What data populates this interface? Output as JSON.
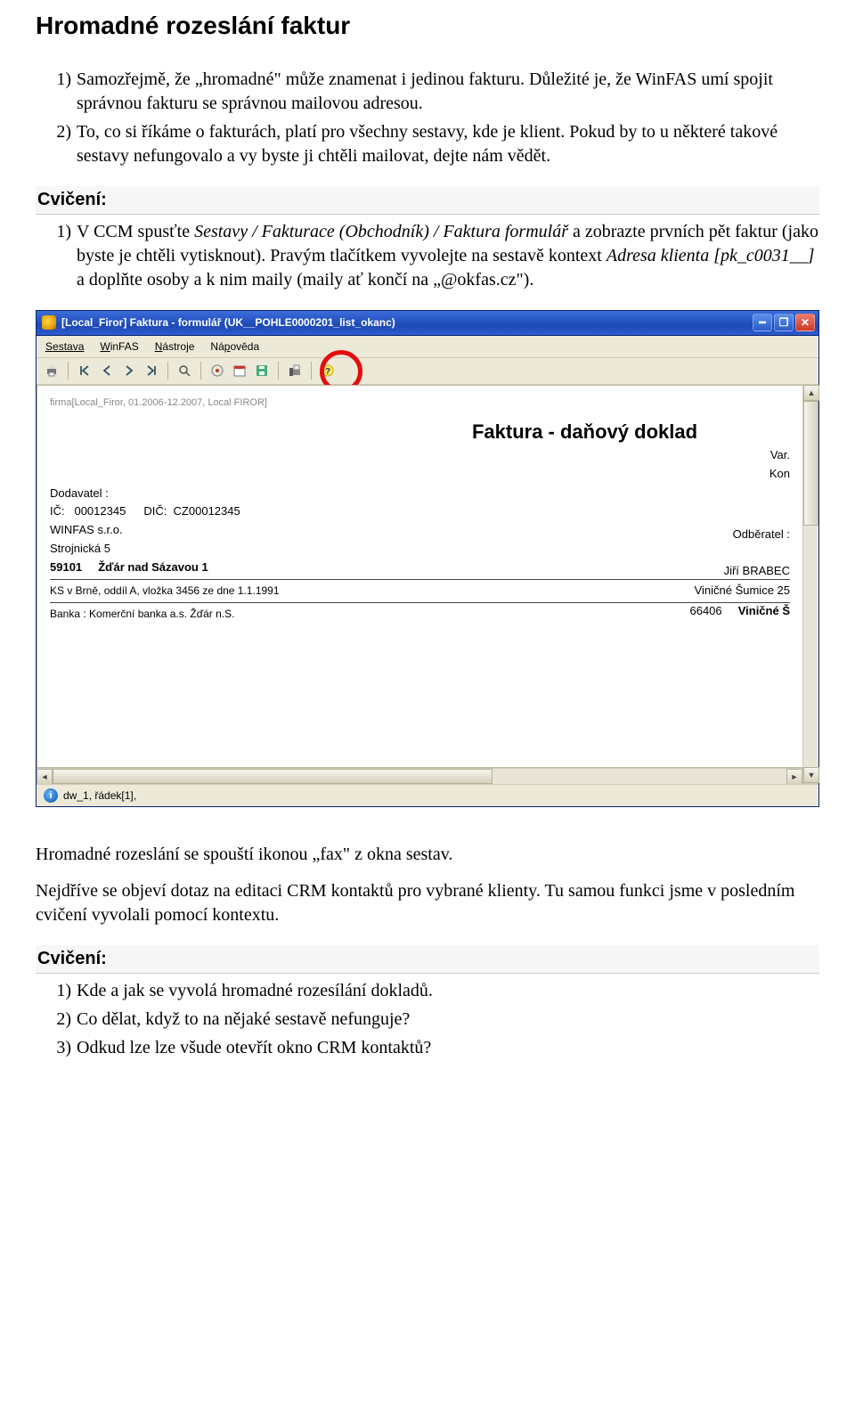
{
  "heading": "Hromadné rozeslání faktur",
  "intro_list": [
    "Samozřejmě, že „hromadné\" může znamenat i jedinou fakturu. Důležité je, že WinFAS umí spojit správnou fakturu se správnou mailovou adresou.",
    "To, co si říkáme o fakturách, platí pro všechny sestavy, kde je klient. Pokud by to u některé takové sestavy nefungovalo a vy byste ji chtěli mailovat, dejte nám vědět."
  ],
  "cviceni_label": "Cvičení:",
  "cviceni1_pre": "V CCM spusťte ",
  "cviceni1_em": "Sestavy / Fakturace (Obchodník) / Faktura formulář",
  "cviceni1_mid": " a zobrazte prvních pět faktur (jako byste je chtěli vytisknout). Pravým tlačítkem vyvolejte na sestavě kontext ",
  "cviceni1_em2": "Adresa klienta [pk_c0031__]",
  "cviceni1_post": " a doplňte osoby a k nim maily (maily ať končí na „@okfas.cz\").",
  "window": {
    "title": "[Local_Firor] Faktura - formulář (UK__POHLE0000201_list_okanc)",
    "menus": [
      "Sestava",
      "WinFAS",
      "Nástroje",
      "Nápověda"
    ],
    "status": "dw_1, řádek[1],"
  },
  "invoice": {
    "meta": "firma[Local_Firor, 01.2006-12.2007, Local FIROR]",
    "title": "Faktura - daňový doklad",
    "var_label": "Var.",
    "kon_label": "Kon",
    "supplier_label": "Dodavatel :",
    "ic_label": "IČ:",
    "ic": "00012345",
    "dic_label": "DIČ:",
    "dic": "CZ00012345",
    "firm": "WINFAS s.r.o.",
    "street": "Strojnická 5",
    "zip": "59101",
    "city": "Žďár nad Sázavou 1",
    "ks": "KS v Brně, oddíl A, vložka 3456 ze dne 1.1.1991",
    "bank": "Banka :   Komerční banka a.s. Žďár n.S.",
    "recipient_label": "Odběratel :",
    "recipient_name": "Jiří BRABEC",
    "recipient_street": "Viničné Šumice 25",
    "recipient_zip": "66406",
    "recipient_city": "Viničné Š"
  },
  "after_para1": "Hromadné rozeslání se spouští ikonou „fax\" z okna sestav.",
  "after_para2": "Nejdříve se objeví dotaz na editaci CRM kontaktů pro vybrané klienty. Tu samou funkci jsme v posledním cvičení vyvolali pomocí kontextu.",
  "cviceni2": [
    "Kde a jak se vyvolá hromadné rozesílání dokladů.",
    "Co dělat, když to na nějaké sestavě nefunguje?",
    "Odkud lze lze všude otevřít okno CRM kontaktů?"
  ]
}
